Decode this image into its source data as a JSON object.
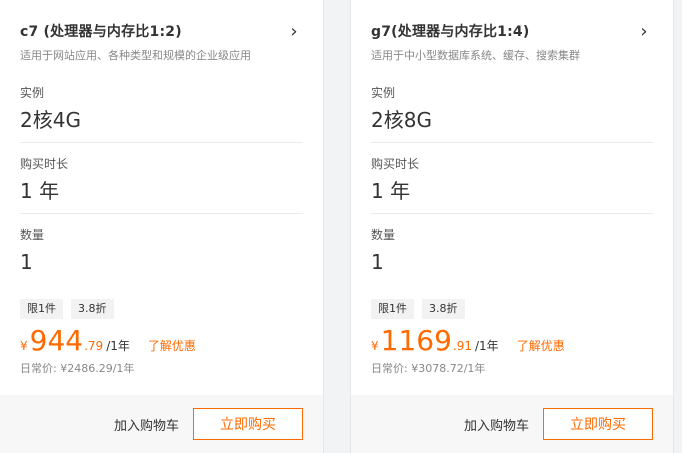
{
  "cards": [
    {
      "title": "c7 (处理器与内存比1:2)",
      "subtitle": "适用于网站应用、各种类型和规模的企业级应用",
      "fields": [
        {
          "label": "实例",
          "value": "2核4G"
        },
        {
          "label": "购买时长",
          "value": "1 年"
        },
        {
          "label": "数量",
          "value": "1"
        }
      ],
      "tags": [
        "限1件",
        "3.8折"
      ],
      "price": {
        "currency": "¥",
        "integer": "944",
        "decimal": ".79",
        "unit": "/1年"
      },
      "discount_link": "了解优惠",
      "regular_price": "日常价: ¥2486.29/1年",
      "cart_label": "加入购物车",
      "buy_label": "立即购买"
    },
    {
      "title": "g7(处理器与内存比1:4)",
      "subtitle": "适用于中小型数据库系统、缓存、搜索集群",
      "fields": [
        {
          "label": "实例",
          "value": "2核8G"
        },
        {
          "label": "购买时长",
          "value": "1 年"
        },
        {
          "label": "数量",
          "value": "1"
        }
      ],
      "tags": [
        "限1件",
        "3.8折"
      ],
      "price": {
        "currency": "¥",
        "integer": "1169",
        "decimal": ".91",
        "unit": "/1年"
      },
      "discount_link": "了解优惠",
      "regular_price": "日常价: ¥3078.72/1年",
      "cart_label": "加入购物车",
      "buy_label": "立即购买"
    }
  ],
  "icons": {
    "chevron": "chevron-right-icon"
  },
  "colors": {
    "accent": "#ff6a00"
  }
}
